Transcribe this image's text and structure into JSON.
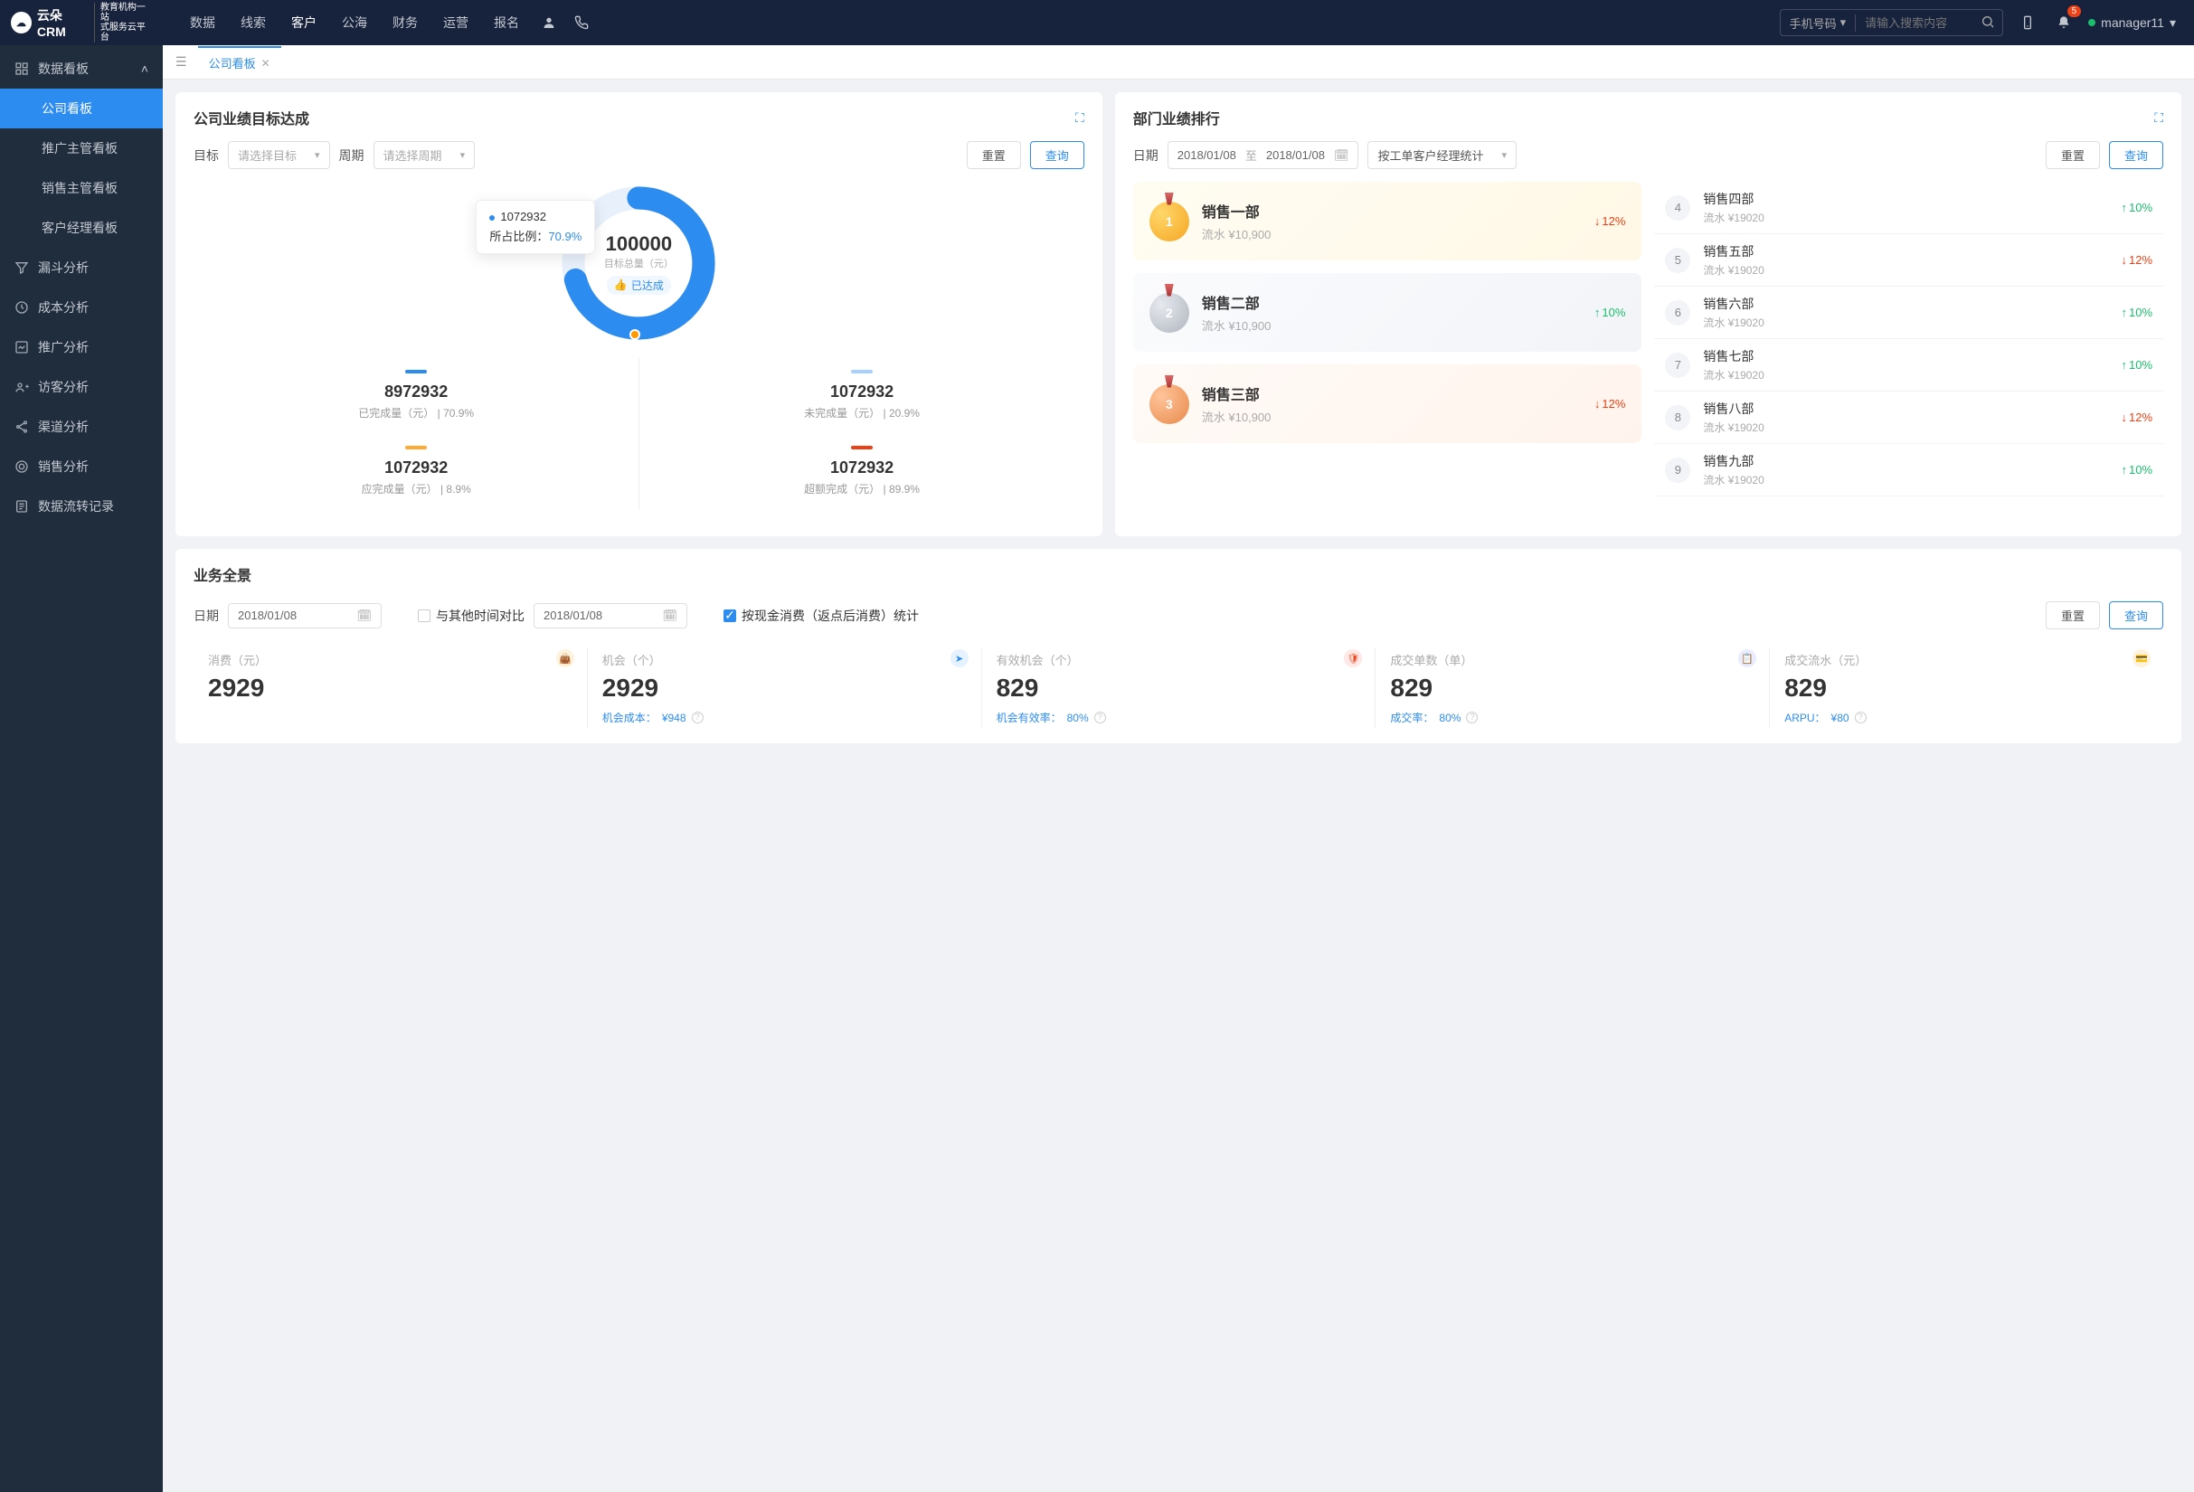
{
  "topbar": {
    "logo_main": "云朵CRM",
    "logo_sub1": "教育机构一站",
    "logo_sub2": "式服务云平台",
    "nav": [
      "数据",
      "线索",
      "客户",
      "公海",
      "财务",
      "运营",
      "报名"
    ],
    "search_type": "手机号码",
    "search_placeholder": "请输入搜索内容",
    "badge_count": "5",
    "username": "manager11"
  },
  "sidebar": {
    "group0": {
      "label": "数据看板"
    },
    "subs": [
      "公司看板",
      "推广主管看板",
      "销售主管看板",
      "客户经理看板"
    ],
    "items": [
      "漏斗分析",
      "成本分析",
      "推广分析",
      "访客分析",
      "渠道分析",
      "销售分析",
      "数据流转记录"
    ]
  },
  "tabs": {
    "active": "公司看板"
  },
  "panel1": {
    "title": "公司业绩目标达成",
    "filter_target_label": "目标",
    "filter_target_placeholder": "请选择目标",
    "filter_period_label": "周期",
    "filter_period_placeholder": "请选择周期",
    "reset": "重置",
    "query": "查询",
    "donut_total": "100000",
    "donut_total_label": "目标总量（元）",
    "donut_status": "已达成",
    "tooltip_value": "1072932",
    "tooltip_label": "所占比例：",
    "tooltip_pct": "70.9%",
    "stats": [
      {
        "color": "#2d8cf0",
        "value": "8972932",
        "label": "已完成量（元）",
        "pct": "70.9%"
      },
      {
        "color": "#a8d0ff",
        "value": "1072932",
        "label": "未完成量（元）",
        "pct": "20.9%"
      },
      {
        "color": "#ffaa33",
        "value": "1072932",
        "label": "应完成量（元）",
        "pct": "8.9%"
      },
      {
        "color": "#ed4014",
        "value": "1072932",
        "label": "超额完成（元）",
        "pct": "89.9%"
      }
    ]
  },
  "panel2": {
    "title": "部门业绩排行",
    "date_label": "日期",
    "date_from": "2018/01/08",
    "date_sep": "至",
    "date_to": "2018/01/08",
    "group_by": "按工单客户经理统计",
    "reset": "重置",
    "query": "查询",
    "top3": [
      {
        "name": "销售一部",
        "flow": "流水 ¥10,900",
        "change": "12%",
        "dir": "down"
      },
      {
        "name": "销售二部",
        "flow": "流水 ¥10,900",
        "change": "10%",
        "dir": "up"
      },
      {
        "name": "销售三部",
        "flow": "流水 ¥10,900",
        "change": "12%",
        "dir": "down"
      }
    ],
    "rest": [
      {
        "rank": "4",
        "name": "销售四部",
        "flow": "流水 ¥19020",
        "change": "10%",
        "dir": "up"
      },
      {
        "rank": "5",
        "name": "销售五部",
        "flow": "流水 ¥19020",
        "change": "12%",
        "dir": "down"
      },
      {
        "rank": "6",
        "name": "销售六部",
        "flow": "流水 ¥19020",
        "change": "10%",
        "dir": "up"
      },
      {
        "rank": "7",
        "name": "销售七部",
        "flow": "流水 ¥19020",
        "change": "10%",
        "dir": "up"
      },
      {
        "rank": "8",
        "name": "销售八部",
        "flow": "流水 ¥19020",
        "change": "12%",
        "dir": "down"
      },
      {
        "rank": "9",
        "name": "销售九部",
        "flow": "流水 ¥19020",
        "change": "10%",
        "dir": "up"
      }
    ]
  },
  "panel3": {
    "title": "业务全景",
    "date_label": "日期",
    "date1": "2018/01/08",
    "compare_label": "与其他时间对比",
    "date2": "2018/01/08",
    "option_label": "按现金消费（返点后消费）统计",
    "reset": "重置",
    "query": "查询",
    "metrics": [
      {
        "label": "消费（元）",
        "value": "2929",
        "sub": "",
        "icon": "#f5a623"
      },
      {
        "label": "机会（个）",
        "value": "2929",
        "sub_label": "机会成本：",
        "sub_val": "¥948",
        "icon": "#2d8cf0"
      },
      {
        "label": "有效机会（个）",
        "value": "829",
        "sub_label": "机会有效率：",
        "sub_val": "80%",
        "icon": "#ed4014"
      },
      {
        "label": "成交单数（单）",
        "value": "829",
        "sub_label": "成交率：",
        "sub_val": "80%",
        "icon": "#4a6cf7"
      },
      {
        "label": "成交流水（元）",
        "value": "829",
        "sub_label": "ARPU：",
        "sub_val": "¥80",
        "icon": "#ff9900"
      }
    ]
  },
  "chart_data": {
    "type": "pie",
    "title": "公司业绩目标达成",
    "total": 100000,
    "total_unit": "元",
    "series": [
      {
        "name": "已完成量",
        "value": 8972932,
        "pct": 70.9,
        "color": "#2d8cf0"
      },
      {
        "name": "未完成量",
        "value": 1072932,
        "pct": 20.9,
        "color": "#a8d0ff"
      },
      {
        "name": "应完成量",
        "value": 1072932,
        "pct": 8.9,
        "color": "#ffaa33"
      },
      {
        "name": "超额完成",
        "value": 1072932,
        "pct": 89.9,
        "color": "#ed4014"
      }
    ]
  }
}
